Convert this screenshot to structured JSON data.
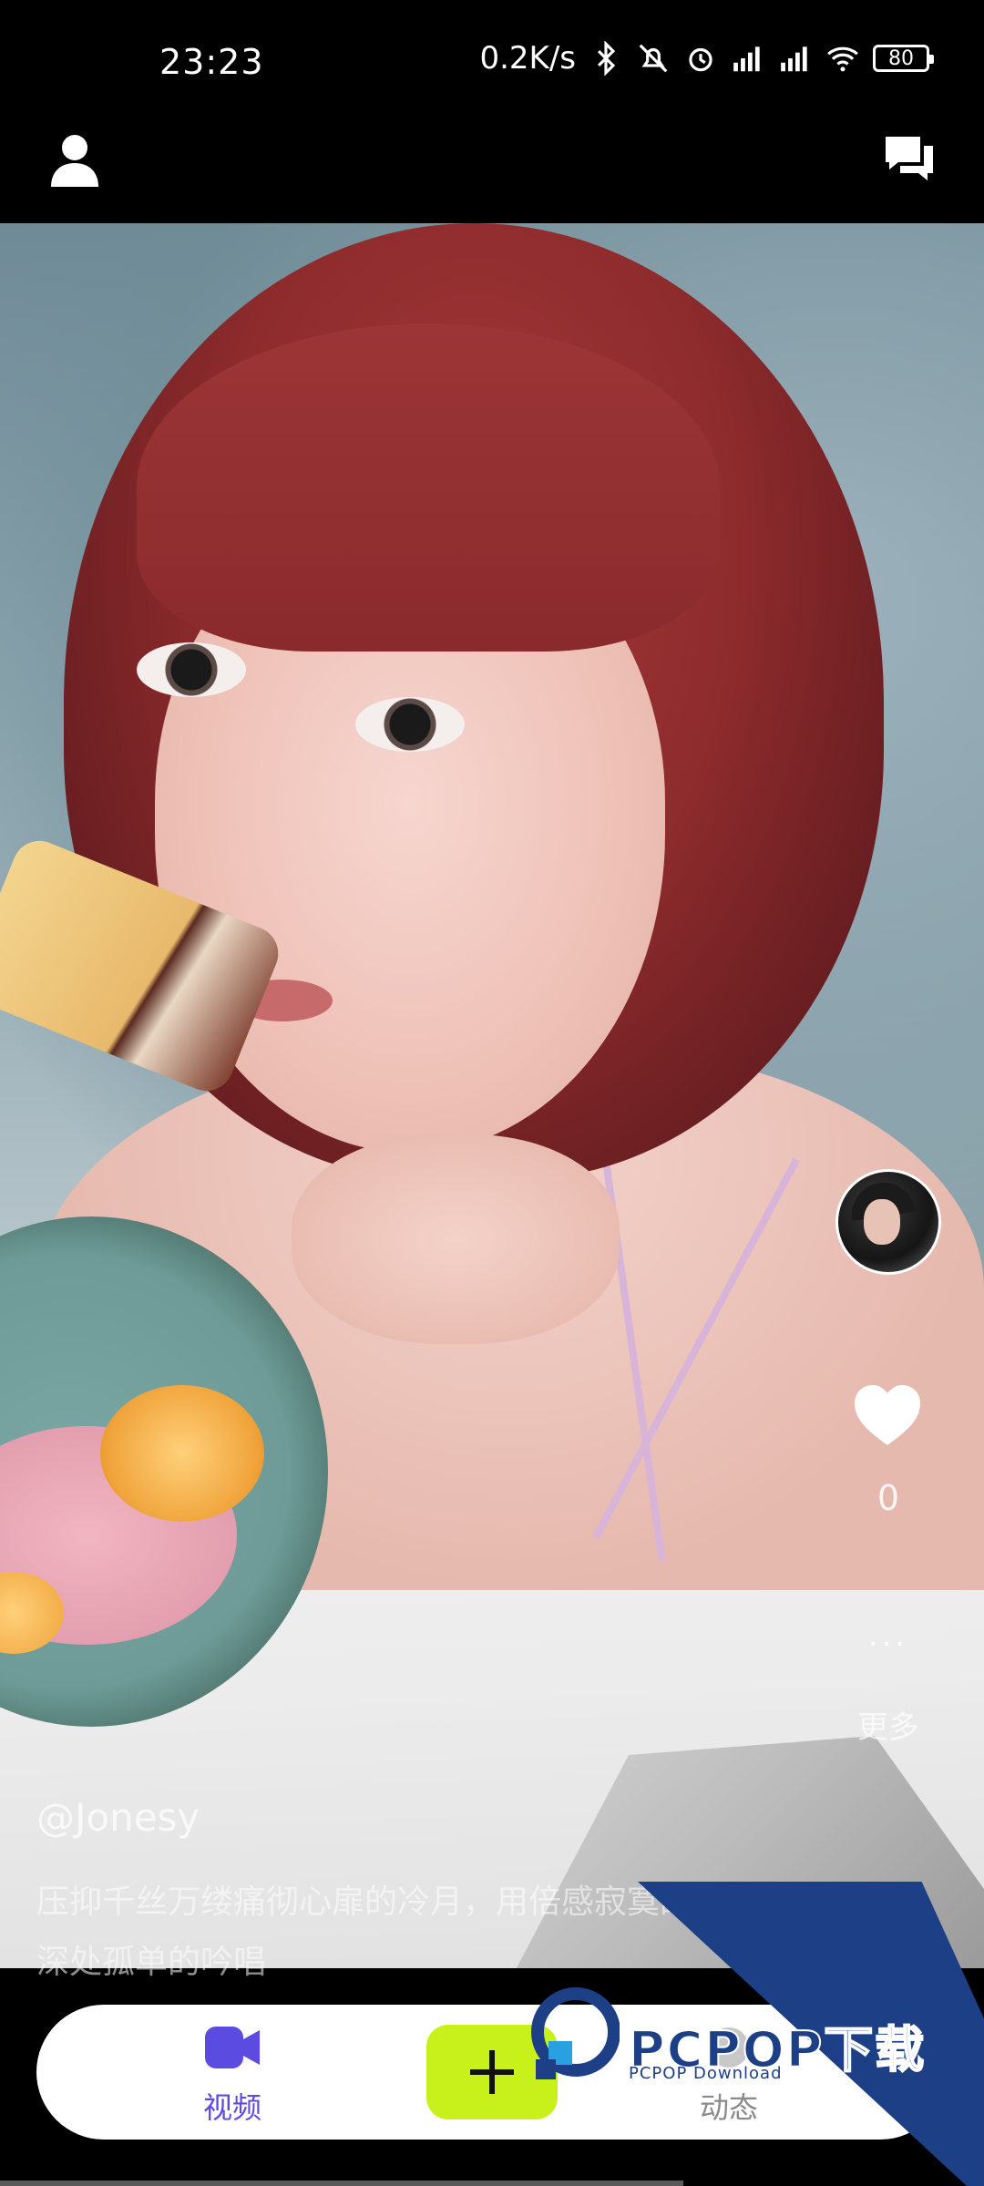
{
  "status_bar": {
    "time": "23:23",
    "network_speed": "0.2K/s",
    "battery": "80",
    "icons": [
      "bluetooth-icon",
      "mute-icon",
      "alarm-icon",
      "signal-hd-icon",
      "signal-hd-icon",
      "wifi-icon",
      "battery-icon"
    ]
  },
  "top_bar": {
    "left_icon": "user-icon",
    "right_icon": "chat-icon"
  },
  "video": {
    "author": "@Jonesy",
    "caption": "压抑千丝万缕痛彻心扉的冷月，用倍感寂寞的歌声，灵魂的深处孤单的吟唱",
    "likes": "0",
    "more_dots": "...",
    "more_label": "更多"
  },
  "bottom_nav": {
    "items": [
      {
        "label": "视频",
        "icon": "video-camera-icon",
        "active": true
      },
      {
        "label": "动态",
        "icon": "feed-icon",
        "active": false
      }
    ],
    "add_icon": "plus-icon"
  },
  "watermark": {
    "text": "PCPOP下载",
    "sub": "PCPOP Download"
  },
  "colors": {
    "accent": "#5b4be1",
    "add_button": "#c8f01a",
    "watermark": "#1c3f86"
  }
}
